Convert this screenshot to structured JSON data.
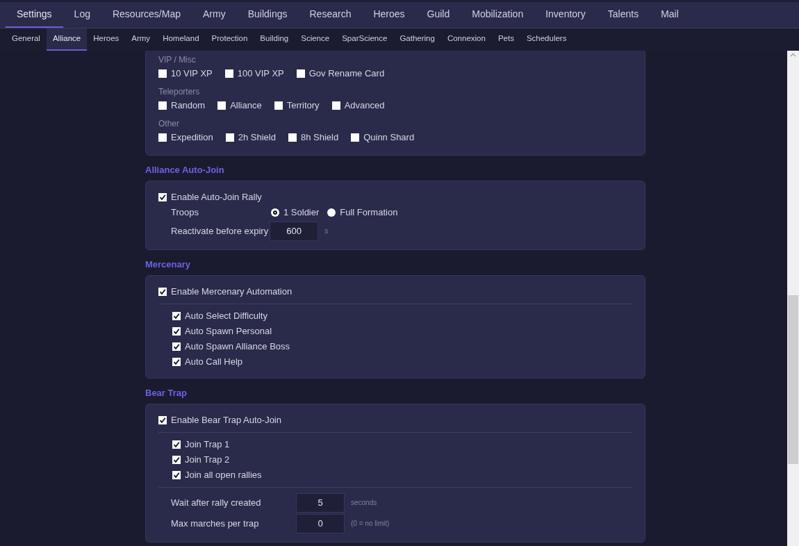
{
  "main_tabs": [
    {
      "label": "Settings",
      "selected": true
    },
    {
      "label": "Log",
      "selected": false
    },
    {
      "label": "Resources/Map",
      "selected": false
    },
    {
      "label": "Army",
      "selected": false
    },
    {
      "label": "Buildings",
      "selected": false
    },
    {
      "label": "Research",
      "selected": false
    },
    {
      "label": "Heroes",
      "selected": false
    },
    {
      "label": "Guild",
      "selected": false
    },
    {
      "label": "Mobilization",
      "selected": false
    },
    {
      "label": "Inventory",
      "selected": false
    },
    {
      "label": "Talents",
      "selected": false
    },
    {
      "label": "Mail",
      "selected": false
    }
  ],
  "sub_tabs": [
    {
      "label": "General",
      "selected": false
    },
    {
      "label": "Alliance",
      "selected": true
    },
    {
      "label": "Heroes",
      "selected": false
    },
    {
      "label": "Army",
      "selected": false
    },
    {
      "label": "Homeland",
      "selected": false
    },
    {
      "label": "Protection",
      "selected": false
    },
    {
      "label": "Building",
      "selected": false
    },
    {
      "label": "Science",
      "selected": false
    },
    {
      "label": "SparScience",
      "selected": false
    },
    {
      "label": "Gathering",
      "selected": false
    },
    {
      "label": "Connexion",
      "selected": false
    },
    {
      "label": "Pets",
      "selected": false
    },
    {
      "label": "Schedulers",
      "selected": false
    }
  ],
  "items_card": {
    "groups": [
      {
        "label": "VIP / Misc",
        "options": [
          {
            "label": "10 VIP XP",
            "checked": false
          },
          {
            "label": "100 VIP XP",
            "checked": false
          },
          {
            "label": "Gov Rename Card",
            "checked": false
          }
        ]
      },
      {
        "label": "Teleporters",
        "options": [
          {
            "label": "Random",
            "checked": false
          },
          {
            "label": "Alliance",
            "checked": false
          },
          {
            "label": "Territory",
            "checked": false
          },
          {
            "label": "Advanced",
            "checked": false
          }
        ]
      },
      {
        "label": "Other",
        "options": [
          {
            "label": "Expedition",
            "checked": false
          },
          {
            "label": "2h Shield",
            "checked": false
          },
          {
            "label": "8h Shield",
            "checked": false
          },
          {
            "label": "Quinn Shard",
            "checked": false
          }
        ]
      }
    ]
  },
  "sections": [
    {
      "heading": "Alliance Auto-Join",
      "rows": [
        {
          "kind": "checkbox",
          "label": "Enable Auto-Join Rally",
          "checked": true
        },
        {
          "kind": "radio",
          "label": "Troops",
          "options": [
            {
              "label": "1 Soldier",
              "selected": true
            },
            {
              "label": "Full Formation",
              "selected": false
            }
          ]
        },
        {
          "kind": "inline-number",
          "label": "Reactivate before expiry",
          "value": "600",
          "unit": "s"
        }
      ]
    },
    {
      "heading": "Mercenary",
      "rows": [
        {
          "kind": "checkbox",
          "label": "Enable Mercenary Automation",
          "checked": true
        },
        {
          "kind": "divider"
        },
        {
          "kind": "sub-checkbox",
          "label": "Auto Select Difficulty",
          "checked": true
        },
        {
          "kind": "sub-checkbox",
          "label": "Auto Spawn Personal",
          "checked": true
        },
        {
          "kind": "sub-checkbox",
          "label": "Auto Spawn Alliance Boss",
          "checked": true
        },
        {
          "kind": "sub-checkbox",
          "label": "Auto Call Help",
          "checked": true
        }
      ]
    },
    {
      "heading": "Bear Trap",
      "rows": [
        {
          "kind": "checkbox",
          "label": "Enable Bear Trap Auto-Join",
          "checked": true
        },
        {
          "kind": "divider"
        },
        {
          "kind": "sub-checkbox",
          "label": "Join Trap 1",
          "checked": true
        },
        {
          "kind": "sub-checkbox",
          "label": "Join Trap 2",
          "checked": true
        },
        {
          "kind": "sub-checkbox",
          "label": "Join all open rallies",
          "checked": true
        },
        {
          "kind": "divider"
        },
        {
          "kind": "number",
          "label": "Wait after rally created",
          "value": "5",
          "unit": "seconds"
        },
        {
          "kind": "number",
          "label": "Max marches per trap",
          "value": "0",
          "unit": "(0 = no limit)"
        }
      ]
    }
  ]
}
